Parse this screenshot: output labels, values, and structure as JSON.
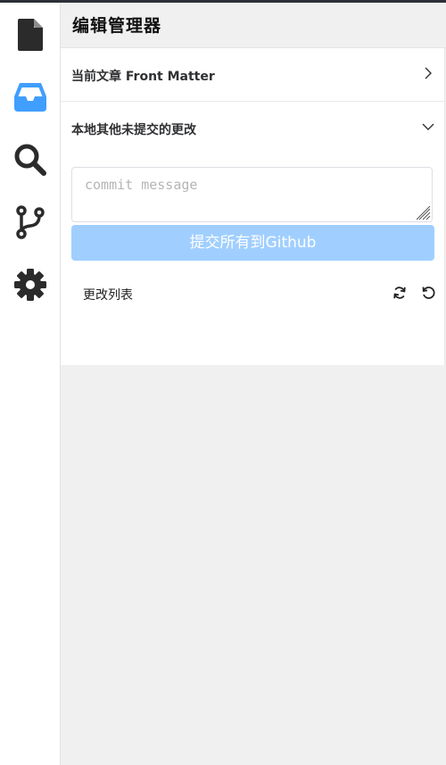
{
  "activity_bar": {
    "items": [
      {
        "icon": "file-icon",
        "active": false
      },
      {
        "icon": "inbox-icon",
        "active": true
      },
      {
        "icon": "search-icon",
        "active": false
      },
      {
        "icon": "git-branch-icon",
        "active": false
      },
      {
        "icon": "gear-icon",
        "active": false
      }
    ],
    "active_color": "#409eff",
    "icon_color": "#2b2b2b"
  },
  "header": {
    "title": "编辑管理器"
  },
  "collapse": {
    "front_matter_label": "当前文章 Front Matter",
    "changes_section_label": "本地其他未提交的更改"
  },
  "commit": {
    "placeholder": "commit message",
    "value": ""
  },
  "submit_button": {
    "label": "提交所有到Github",
    "color": "#a0cfff"
  },
  "changes_list": {
    "label": "更改列表",
    "refresh_icon": "refresh-icon",
    "undo_icon": "undo-icon"
  }
}
